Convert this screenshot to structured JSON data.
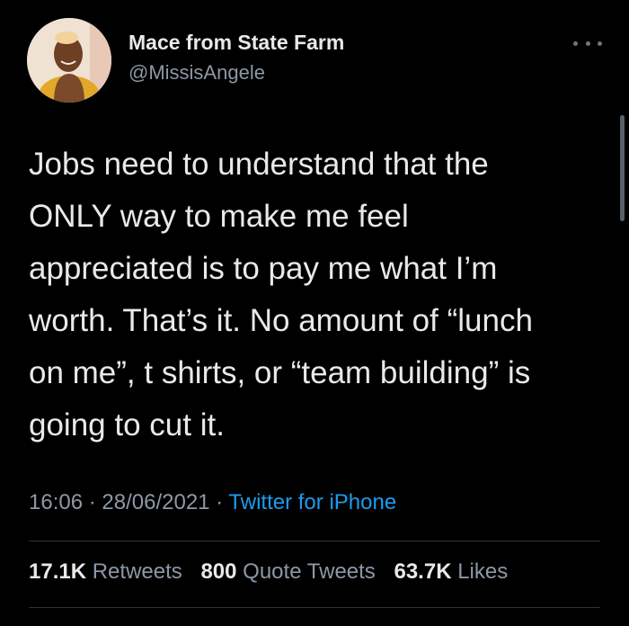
{
  "author": {
    "display_name": "Mace from State Farm",
    "handle": "@MissisAngele",
    "avatar_icon": "profile-photo"
  },
  "menu": {
    "icon": "more-horizontal-icon"
  },
  "tweet": {
    "lines": [
      "Jobs need to understand that the",
      "ONLY way to make me feel",
      "appreciated is to pay me what I’m",
      "worth. That’s it. No amount of “lunch",
      "on me”, t shirts, or “team building” is",
      "going to cut it."
    ]
  },
  "meta": {
    "time": "16:06",
    "sep1": " · ",
    "date": "28/06/2021",
    "sep2": " · ",
    "source": "Twitter for iPhone"
  },
  "stats": {
    "retweets_count": "17.1K",
    "retweets_label": "Retweets",
    "quotes_count": "800",
    "quotes_label": "Quote Tweets",
    "likes_count": "63.7K",
    "likes_label": "Likes"
  },
  "colors": {
    "background": "#000000",
    "text": "#e7e9ea",
    "secondary_text": "#8b98a5",
    "link": "#1d9bf0",
    "divider": "#2f3336"
  }
}
